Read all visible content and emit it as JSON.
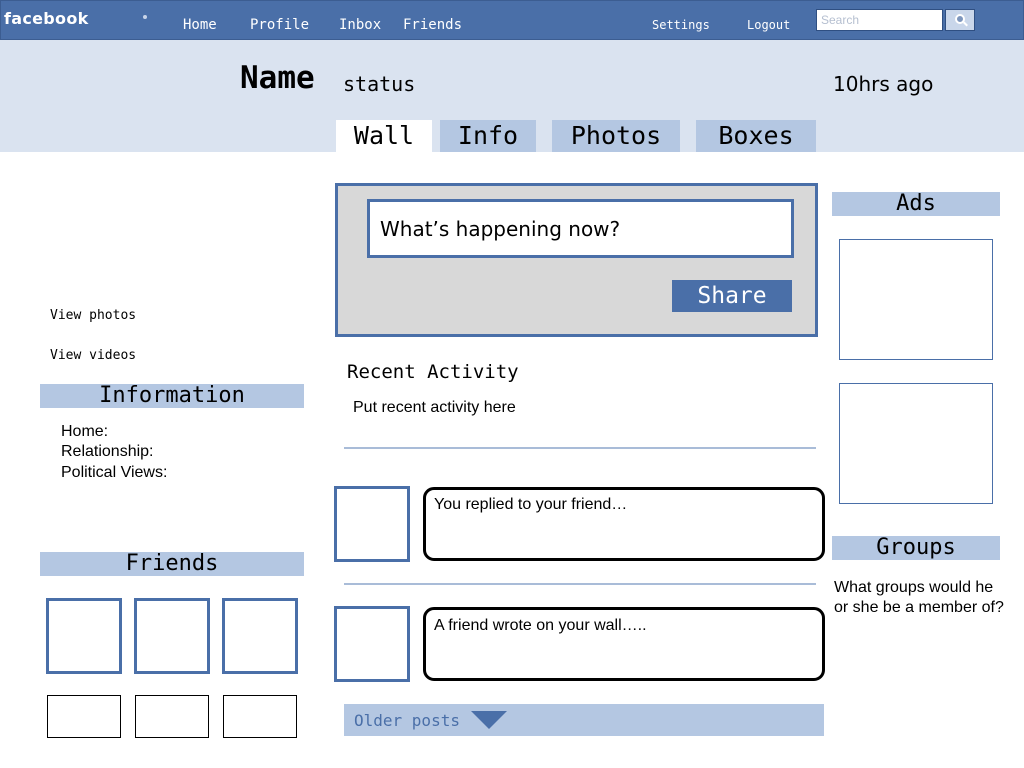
{
  "topbar": {
    "logo_text": "facebook",
    "nav": [
      "Home",
      "Profile",
      "Inbox",
      "Friends"
    ],
    "settings_label": "Settings",
    "logout_label": "Logout",
    "search_placeholder": "Search",
    "search_icon": "search-icon"
  },
  "profile": {
    "name": "Name",
    "status": "status",
    "time_ago": "10hrs ago",
    "tabs": [
      "Wall",
      "Info",
      "Photos",
      "Boxes"
    ],
    "active_tab": "Wall"
  },
  "left": {
    "view_photos": "View photos",
    "view_videos": "View videos",
    "information_heading": "Information",
    "info_lines": [
      "Home:",
      "Relationship:",
      "Political Views:"
    ],
    "friends_heading": "Friends"
  },
  "wall": {
    "composer_placeholder": "What’s happening now?",
    "share_label": "Share",
    "recent_activity_heading": "Recent Activity",
    "recent_activity_placeholder": "Put recent activity here",
    "posts": [
      "You replied to your friend…",
      "A friend wrote on your wall….."
    ],
    "older_posts_label": "Older posts",
    "older_posts_icon": "triangle-down-icon"
  },
  "right": {
    "ads_heading": "Ads",
    "groups_heading": "Groups",
    "groups_text": "What groups would he or she be  a member of?"
  },
  "colors": {
    "brand_blue": "#4a6fa8",
    "light_blue": "#b4c7e2",
    "header_band": "#dae3f0",
    "composer_gray": "#d8d8d8"
  }
}
